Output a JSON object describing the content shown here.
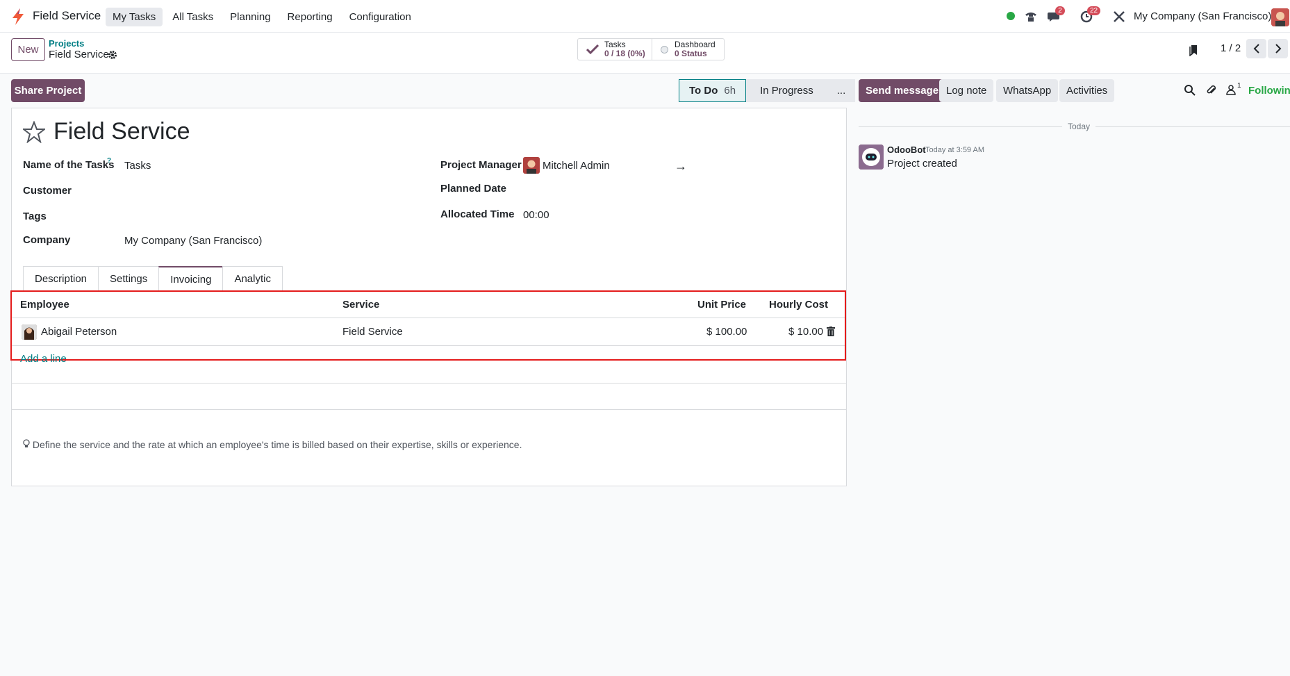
{
  "app": {
    "name": "Field Service"
  },
  "menu": [
    "My Tasks",
    "All Tasks",
    "Planning",
    "Reporting",
    "Configuration"
  ],
  "systray": {
    "messages_badge": "2",
    "activities_badge": "22",
    "company": "My Company (San Francisco)"
  },
  "control_panel": {
    "new_label": "New",
    "breadcrumb_parent": "Projects",
    "breadcrumb_current": "Field Service",
    "smart_tasks_label": "Tasks",
    "smart_tasks_value": "0 / 18 (0%)",
    "smart_dashboard_label": "Dashboard",
    "smart_dashboard_value": "0 Status",
    "pager": "1 / 2"
  },
  "statusbar": {
    "share_label": "Share Project",
    "stages": [
      {
        "label": "To Do",
        "extra": "6h"
      },
      {
        "label": "In Progress",
        "extra": ""
      },
      {
        "label": "...",
        "extra": ""
      }
    ]
  },
  "form": {
    "title": "Field Service",
    "name_of_tasks_label": "Name of the Tasks",
    "name_of_tasks_tip": "?",
    "name_of_tasks_value": "Tasks",
    "customer_label": "Customer",
    "tags_label": "Tags",
    "company_label": "Company",
    "company_value": "My Company (San Francisco)",
    "project_manager_label": "Project Manager",
    "project_manager_value": "Mitchell Admin",
    "planned_date_label": "Planned Date",
    "allocated_time_label": "Allocated Time",
    "allocated_time_value": "00:00",
    "tabs": [
      "Description",
      "Settings",
      "Invoicing",
      "Analytic"
    ],
    "active_tab": "Invoicing"
  },
  "invoicing_table": {
    "headers": [
      "Employee",
      "Service",
      "Unit Price",
      "Hourly Cost"
    ],
    "rows": [
      {
        "employee": "Abigail Peterson",
        "service": "Field Service",
        "unit_price": "$ 100.00",
        "hourly_cost": "$ 10.00"
      }
    ],
    "add_line": "Add a line"
  },
  "hint": "Define the service and the rate at which an employee's time is billed based on their expertise, skills or experience.",
  "chatter": {
    "send_message": "Send message",
    "log_note": "Log note",
    "whatsapp": "WhatsApp",
    "activities": "Activities",
    "followers_count": "1",
    "following": "Following",
    "date_separator": "Today",
    "messages": [
      {
        "author": "OdooBot",
        "time": "Today at 3:59 AM",
        "body": "Project created"
      }
    ]
  },
  "colors": {
    "brand": "#714b67",
    "link": "#017e84",
    "highlight_border": "#e41b1b",
    "badge": "#d44c59",
    "presence": "#28a745"
  }
}
